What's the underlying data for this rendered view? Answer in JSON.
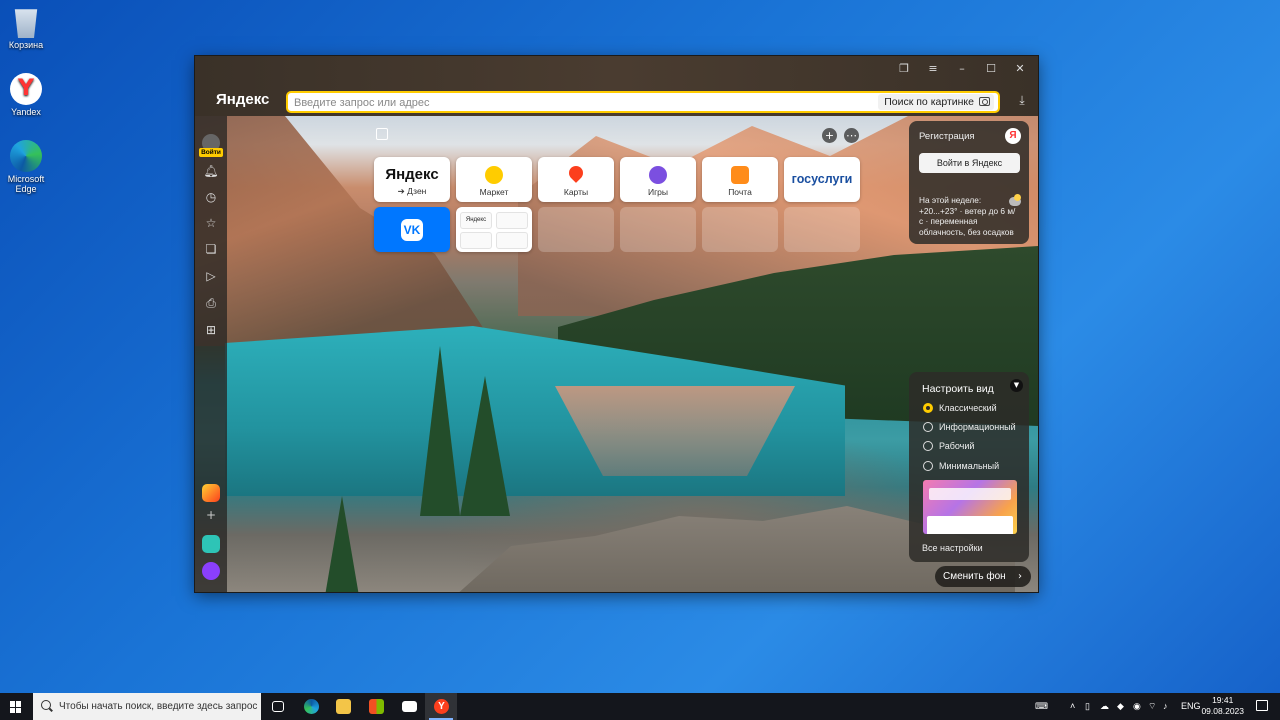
{
  "desktop": {
    "icons": [
      {
        "label": "Корзина"
      },
      {
        "label": "Yandex"
      },
      {
        "label": "Microsoft Edge"
      }
    ]
  },
  "browser": {
    "logo": "Яндекс",
    "address_placeholder": "Введите запрос или адрес",
    "image_search_label": "Поиск по картинке",
    "sidebar": {
      "login_label": "Войти",
      "items": [
        "bell-icon",
        "history-icon",
        "star-icon",
        "collections-icon",
        "play-icon",
        "screenshot-icon",
        "apps-icon"
      ]
    },
    "tiles": [
      {
        "title": "Яндекс",
        "subtitle": "➔ Дзен"
      },
      {
        "label": "Маркет",
        "color": "#ffcc00"
      },
      {
        "label": "Карты",
        "color": "#fc3f1d"
      },
      {
        "label": "Игры",
        "color": "#7b4fe0"
      },
      {
        "label": "Почта",
        "color": "#ff8c1a"
      },
      {
        "title": "госуслуги"
      },
      {
        "title": "VK"
      }
    ],
    "mini_tiles": [
      "Яндекс",
      "",
      "",
      ""
    ],
    "account_panel": {
      "title": "Регистрация",
      "login_button": "Войти в Яндекс",
      "weather": "На этой неделе: +20...+23° · ветер до 6 м/с · переменная облачность, без осадков"
    },
    "view_panel": {
      "title": "Настроить вид",
      "options": [
        {
          "label": "Классический",
          "selected": true
        },
        {
          "label": "Информационный",
          "selected": false
        },
        {
          "label": "Рабочий",
          "selected": false
        },
        {
          "label": "Минимальный",
          "selected": false
        }
      ],
      "all_settings": "Все настройки"
    },
    "change_background": "Сменить фон"
  },
  "taskbar": {
    "search_placeholder": "Чтобы начать поиск, введите здесь запрос",
    "language": "ENG",
    "time": "19:41",
    "date": "09.08.2023"
  },
  "colors": {
    "accent": "#ffcc00",
    "desktop_blue": "#1a74d6",
    "vk_blue": "#0077ff"
  }
}
